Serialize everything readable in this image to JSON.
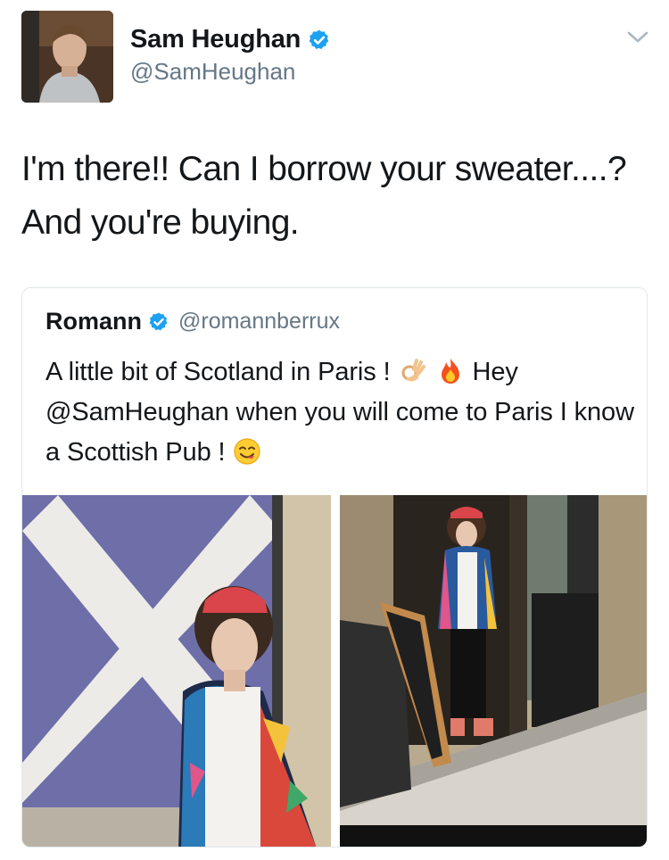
{
  "author": {
    "name": "Sam Heughan",
    "handle": "@SamHeughan",
    "verified": true,
    "avatar": "profile-photo"
  },
  "tweet": {
    "text_line1": "I'm there!! Can I borrow your sweater....?",
    "text_line2": "And you're buying."
  },
  "quoted": {
    "name": "Romann",
    "handle": "@romannberrux",
    "verified": true,
    "text_part1": "A little bit of Scotland in Paris !",
    "emoji1": "ok-hand-icon",
    "emoji2": "fire-icon",
    "text_part2": "Hey @SamHeughan when you will come to Paris I know a Scottish Pub !",
    "emoji3": "smiling-face-icon",
    "photos": [
      "photo-scottish-flag",
      "photo-pub-doorway"
    ]
  },
  "colors": {
    "verified_blue": "#1da1f2",
    "handle_gray": "#657786",
    "text": "#14171a",
    "border": "#e1e8ed"
  }
}
